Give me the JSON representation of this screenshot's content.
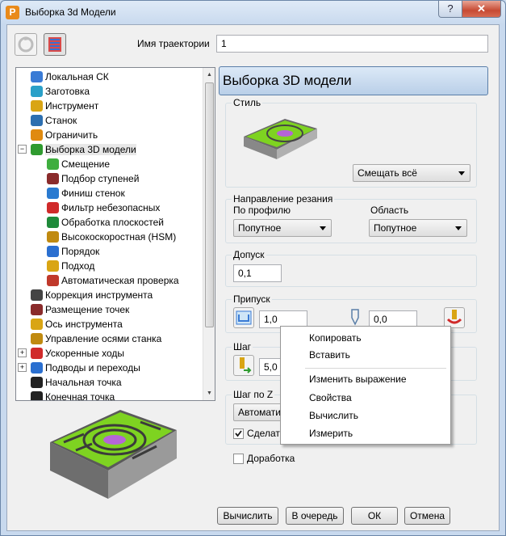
{
  "window": {
    "title": "Выборка 3d Модели",
    "app_icon": "P",
    "help_label": "?",
    "close_label": "✕"
  },
  "trajectory": {
    "label": "Имя траектории",
    "value": "1"
  },
  "tree": {
    "items": [
      {
        "label": "Локальная СК",
        "icon": "csys-icon",
        "color": "#3a7bd5"
      },
      {
        "label": "Заготовка",
        "icon": "block-icon",
        "color": "#2aa0c8"
      },
      {
        "label": "Инструмент",
        "icon": "tool-icon",
        "color": "#d9a514"
      },
      {
        "label": "Станок",
        "icon": "machine-icon",
        "color": "#2d6fb0"
      },
      {
        "label": "Ограничить",
        "icon": "limit-icon",
        "color": "#e08a10"
      },
      {
        "label": "Выборка 3D модели",
        "icon": "model-area-clearance-icon",
        "color": "#2f9b2f"
      },
      {
        "label": "Смещение",
        "icon": "offset-icon",
        "color": "#3fae3f"
      },
      {
        "label": "Подбор ступеней",
        "icon": "steps-icon",
        "color": "#8a2b2b"
      },
      {
        "label": "Финиш стенок",
        "icon": "wall-finish-icon",
        "color": "#2a7ad0"
      },
      {
        "label": "Фильтр небезопасных",
        "icon": "unsafe-filter-icon",
        "color": "#d02a2a"
      },
      {
        "label": "Обработка плоскостей",
        "icon": "flat-machining-icon",
        "color": "#1f8a3a"
      },
      {
        "label": "Высокоскоростная (HSM)",
        "icon": "hsm-icon",
        "color": "#c08a10"
      },
      {
        "label": "Порядок",
        "icon": "order-icon",
        "color": "#2a6fd0"
      },
      {
        "label": "Подход",
        "icon": "approach-icon",
        "color": "#d9a514"
      },
      {
        "label": "Автоматическая проверка",
        "icon": "auto-verify-icon",
        "color": "#c0392b"
      },
      {
        "label": "Коррекция инструмента",
        "icon": "tool-compensation-icon",
        "color": "#444444"
      },
      {
        "label": "Размещение точек",
        "icon": "point-distribution-icon",
        "color": "#8a2b2b"
      },
      {
        "label": "Ось инструмента",
        "icon": "tool-axis-icon",
        "color": "#d9a514"
      },
      {
        "label": "Управление осями станка",
        "icon": "axis-control-icon",
        "color": "#c08a10"
      },
      {
        "label": "Ускоренные ходы",
        "icon": "rapid-moves-icon",
        "color": "#d02a2a"
      },
      {
        "label": "Подводы и переходы",
        "icon": "leads-links-icon",
        "color": "#2a6fd0"
      },
      {
        "label": "Начальная точка",
        "icon": "start-point-icon",
        "color": "#222222"
      },
      {
        "label": "Конечная точка",
        "icon": "end-point-icon",
        "color": "#222222"
      }
    ]
  },
  "panel": {
    "header": "Выборка 3D модели"
  },
  "style_group": {
    "title": "Стиль",
    "combo_value": "Смещать всё"
  },
  "cut_direction": {
    "title": "Направление резания",
    "profile_label": "По профилю",
    "profile_value": "Попутное",
    "area_label": "Область",
    "area_value": "Попутное"
  },
  "tolerance": {
    "title": "Допуск",
    "value": "0,1"
  },
  "thickness": {
    "title": "Припуск",
    "value": "1,0",
    "value2": "0,0"
  },
  "stepover": {
    "title": "Шаг",
    "value": "5,0"
  },
  "stepdown": {
    "title": "Шаг по Z",
    "combo_value": "Автомати",
    "checkbox_label": "Сделать",
    "checkbox_checked": true
  },
  "rest": {
    "label": "Доработка",
    "checked": false
  },
  "context_menu": {
    "items": [
      "Копировать",
      "Вставить",
      "Изменить выражение",
      "Свойства",
      "Вычислить",
      "Измерить"
    ]
  },
  "buttons": {
    "calculate": "Вычислить",
    "queue": "В очередь",
    "ok": "ОК",
    "cancel": "Отмена"
  },
  "colors": {
    "accent_green": "#7ed321",
    "magenta": "#b565d8",
    "header_blue": "#b9cfe8"
  }
}
